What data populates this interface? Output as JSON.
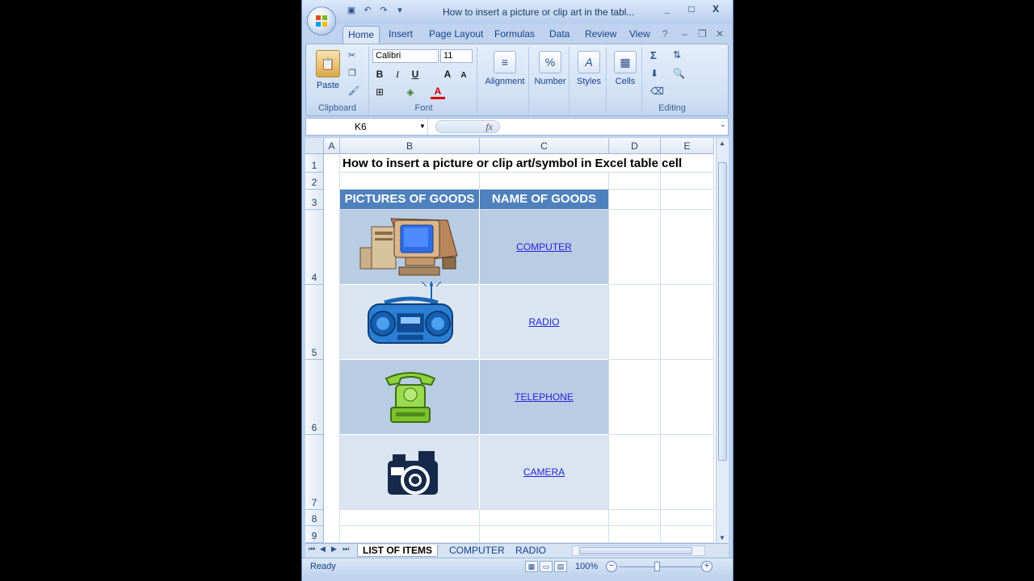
{
  "window": {
    "title": "How to insert a picture or clip art in the tabl...",
    "controls": [
      "_",
      "□",
      "X"
    ]
  },
  "ribbon_tabs": [
    "Home",
    "Insert",
    "Page Layout",
    "Formulas",
    "Data",
    "Review",
    "View"
  ],
  "ribbon": {
    "clipboard": {
      "paste": "Paste",
      "label": "Clipboard"
    },
    "font": {
      "name": "Calibri",
      "size": "11",
      "bold": "B",
      "italic": "I",
      "underline": "U",
      "grow": "A",
      "shrink": "A",
      "label": "Font"
    },
    "alignment": "Alignment",
    "number": "Number",
    "number_glyph": "%",
    "styles": "Styles",
    "cells": "Cells",
    "editing": {
      "label": "Editing",
      "sum": "Σ"
    }
  },
  "formula_bar": {
    "name_box": "K6",
    "fx": "fx",
    "formula": ""
  },
  "columns": [
    "A",
    "B",
    "C",
    "D",
    "E"
  ],
  "rows": [
    "1",
    "2",
    "3",
    "4",
    "5",
    "6",
    "7",
    "8",
    "9"
  ],
  "sheet": {
    "title": "How to insert a picture or clip art/symbol in Excel table cell",
    "headers": [
      "PICTURES OF GOODS",
      "NAME OF GOODS"
    ],
    "items": [
      {
        "picture": "computer-clipart",
        "name": "COMPUTER"
      },
      {
        "picture": "radio-clipart",
        "name": "RADIO"
      },
      {
        "picture": "telephone-clipart",
        "name": "TELEPHONE"
      },
      {
        "picture": "camera-clipart",
        "name": "CAMERA"
      }
    ]
  },
  "sheet_tabs": [
    "LIST OF ITEMS",
    "COMPUTER",
    "RADIO"
  ],
  "active_sheet": "LIST OF ITEMS",
  "status": {
    "ready": "Ready",
    "zoom": "100%"
  },
  "colors": {
    "header_fill": "#4f81bd",
    "band_dark": "#b8cce4",
    "band_light": "#dbe5f1",
    "link": "#2424d8"
  }
}
